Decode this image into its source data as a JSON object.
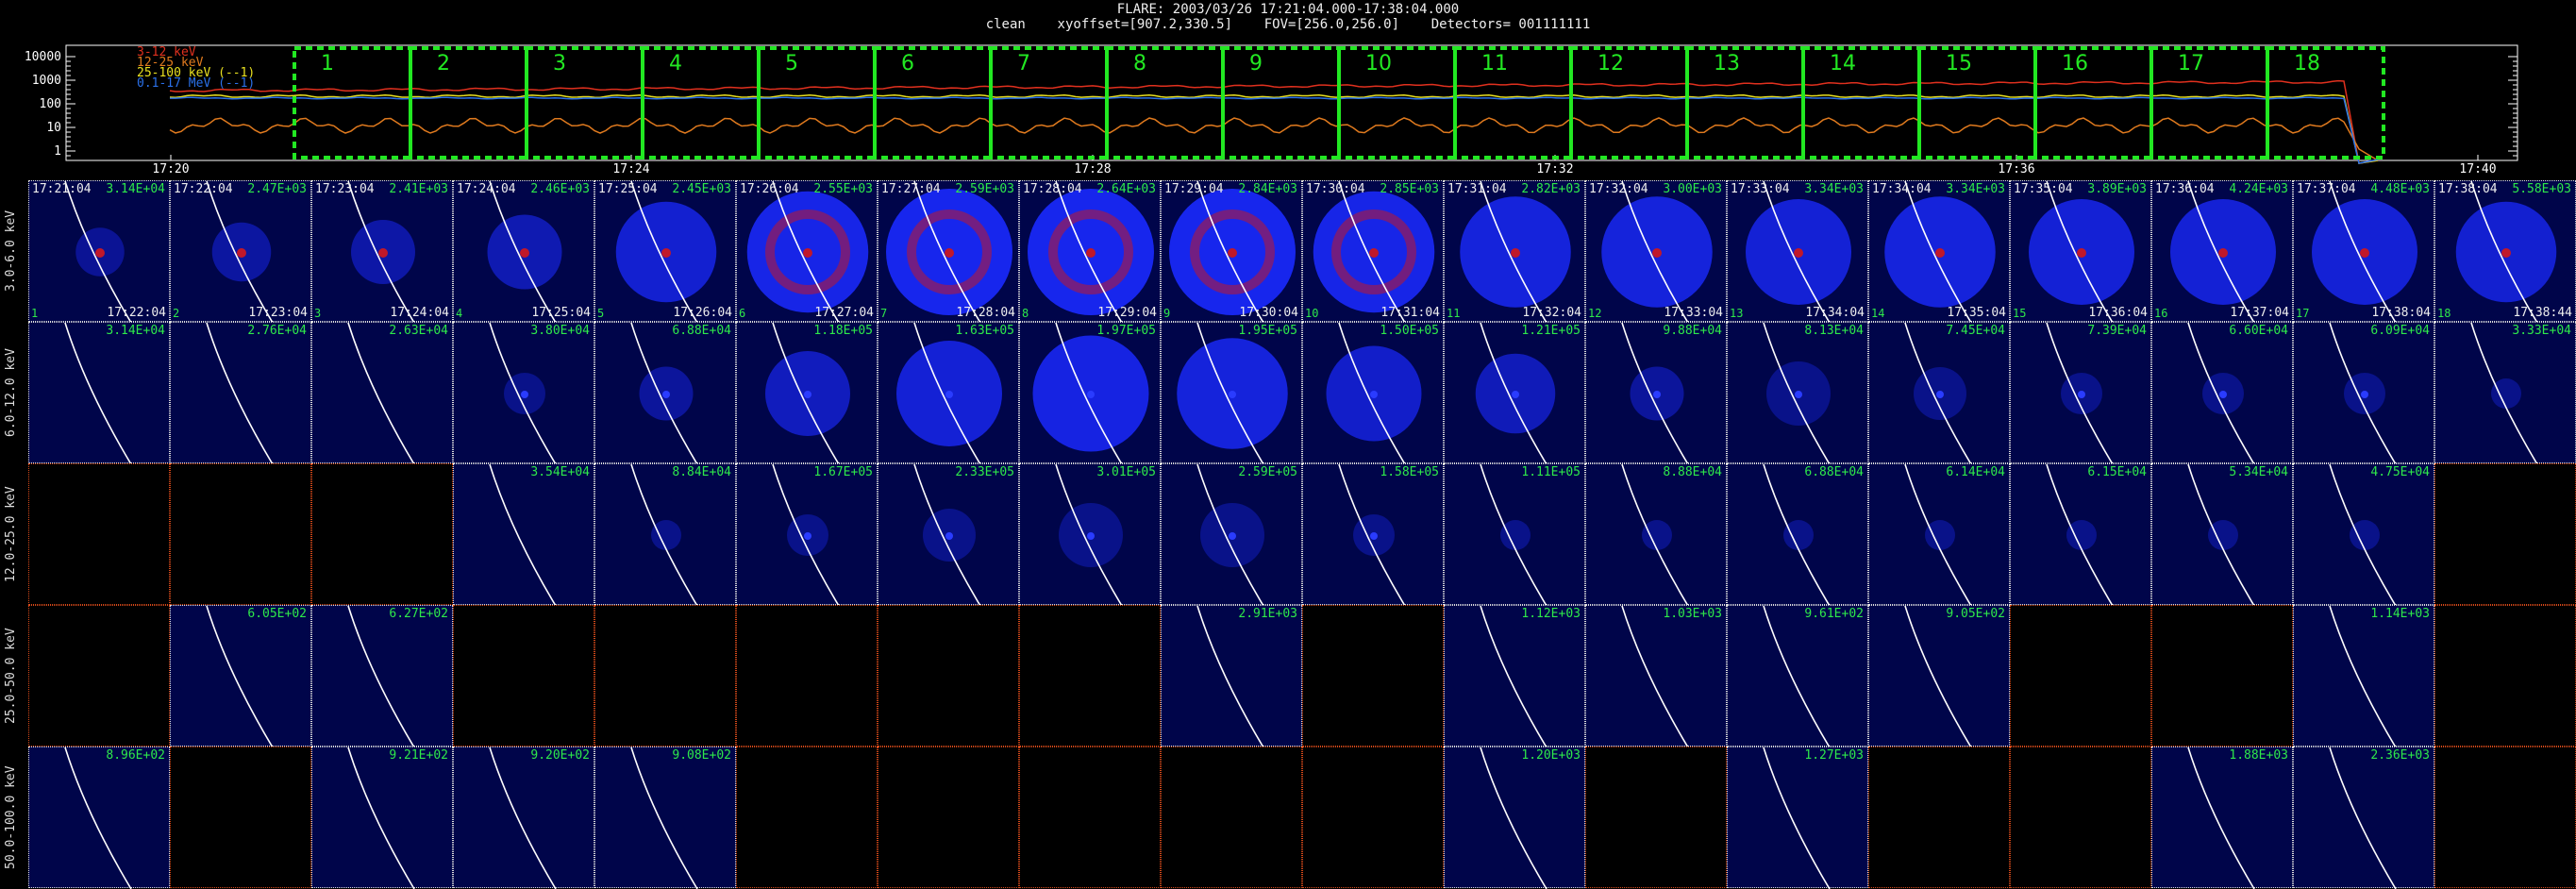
{
  "header": {
    "line1": "FLARE: 2003/03/26 17:21:04.000-17:38:04.000",
    "line2": "clean    xyoffset=[907.2,330.5]    FOV=[256.0,256.0]    Detectors= 001111111"
  },
  "lightcurve": {
    "y_ticks": [
      "10000",
      "1000",
      "100",
      "10",
      "1"
    ],
    "x_ticks": [
      "17:20",
      "17:24",
      "17:28",
      "17:32",
      "17:36",
      "17:40"
    ],
    "legend": [
      {
        "label": "3-12 keV",
        "color": "#e0301e"
      },
      {
        "label": "12-25 keV",
        "color": "#e07a1e"
      },
      {
        "label": "25-100 keV (--1)",
        "color": "#e8e020"
      },
      {
        "label": "0.1-17 MeV (--1)",
        "color": "#2a70e8"
      }
    ],
    "intervals": [
      "1",
      "2",
      "3",
      "4",
      "5",
      "6",
      "7",
      "8",
      "9",
      "10",
      "11",
      "12",
      "13",
      "14",
      "15",
      "16",
      "17",
      "18"
    ],
    "interval_color": "#22e822"
  },
  "row_labels": [
    "3.0-6.0 keV",
    "6.0-12.0 keV",
    "12.0-25.0 keV",
    "25.0-50.0 keV",
    "50.0-100.0 keV"
  ],
  "start_times": [
    "17:21:04",
    "17:22:04",
    "17:23:04",
    "17:24:04",
    "17:25:04",
    "17:26:04",
    "17:27:04",
    "17:28:04",
    "17:29:04",
    "17:30:04",
    "17:31:04",
    "17:32:04",
    "17:33:04",
    "17:34:04",
    "17:35:04",
    "17:36:04",
    "17:37:04",
    "17:38:04"
  ],
  "end_times": [
    "17:22:04",
    "17:23:04",
    "17:24:04",
    "17:25:04",
    "17:26:04",
    "17:27:04",
    "17:28:04",
    "17:29:04",
    "17:30:04",
    "17:31:04",
    "17:32:04",
    "17:33:04",
    "17:34:04",
    "17:35:04",
    "17:36:04",
    "17:37:04",
    "17:38:04",
    "17:38:44"
  ],
  "rows": [
    {
      "cells": [
        {
          "show": true,
          "peak": "3.14E+04"
        },
        {
          "show": true,
          "peak": "2.47E+03"
        },
        {
          "show": true,
          "peak": "2.41E+03"
        },
        {
          "show": true,
          "peak": "2.46E+03"
        },
        {
          "show": true,
          "peak": "2.45E+03"
        },
        {
          "show": true,
          "peak": "2.55E+03"
        },
        {
          "show": true,
          "peak": "2.59E+03"
        },
        {
          "show": true,
          "peak": "2.64E+03"
        },
        {
          "show": true,
          "peak": "2.84E+03"
        },
        {
          "show": true,
          "peak": "2.85E+03"
        },
        {
          "show": true,
          "peak": "2.82E+03"
        },
        {
          "show": true,
          "peak": "3.00E+03"
        },
        {
          "show": true,
          "peak": "3.34E+03"
        },
        {
          "show": true,
          "peak": "3.34E+03"
        },
        {
          "show": true,
          "peak": "3.89E+03"
        },
        {
          "show": true,
          "peak": "4.24E+03"
        },
        {
          "show": true,
          "peak": "4.48E+03"
        },
        {
          "show": true,
          "peak": "5.58E+03"
        }
      ]
    },
    {
      "cells": [
        {
          "show": true,
          "peak": "3.14E+04"
        },
        {
          "show": true,
          "peak": "2.76E+04"
        },
        {
          "show": true,
          "peak": "2.63E+04"
        },
        {
          "show": true,
          "peak": "3.80E+04"
        },
        {
          "show": true,
          "peak": "6.88E+04"
        },
        {
          "show": true,
          "peak": "1.18E+05"
        },
        {
          "show": true,
          "peak": "1.63E+05"
        },
        {
          "show": true,
          "peak": "1.97E+05"
        },
        {
          "show": true,
          "peak": "1.95E+05"
        },
        {
          "show": true,
          "peak": "1.50E+05"
        },
        {
          "show": true,
          "peak": "1.21E+05"
        },
        {
          "show": true,
          "peak": "9.88E+04"
        },
        {
          "show": true,
          "peak": "8.13E+04"
        },
        {
          "show": true,
          "peak": "7.45E+04"
        },
        {
          "show": true,
          "peak": "7.39E+04"
        },
        {
          "show": true,
          "peak": "6.60E+04"
        },
        {
          "show": true,
          "peak": "6.09E+04"
        },
        {
          "show": true,
          "peak": "3.33E+04"
        }
      ]
    },
    {
      "cells": [
        {
          "show": false,
          "peak": ""
        },
        {
          "show": false,
          "peak": ""
        },
        {
          "show": false,
          "peak": ""
        },
        {
          "show": true,
          "peak": "3.54E+04"
        },
        {
          "show": true,
          "peak": "8.84E+04"
        },
        {
          "show": true,
          "peak": "1.67E+05"
        },
        {
          "show": true,
          "peak": "2.33E+05"
        },
        {
          "show": true,
          "peak": "3.01E+05"
        },
        {
          "show": true,
          "peak": "2.59E+05"
        },
        {
          "show": true,
          "peak": "1.58E+05"
        },
        {
          "show": true,
          "peak": "1.11E+05"
        },
        {
          "show": true,
          "peak": "8.88E+04"
        },
        {
          "show": true,
          "peak": "6.88E+04"
        },
        {
          "show": true,
          "peak": "6.14E+04"
        },
        {
          "show": true,
          "peak": "6.15E+04"
        },
        {
          "show": true,
          "peak": "5.34E+04"
        },
        {
          "show": true,
          "peak": "4.75E+04"
        },
        {
          "show": false,
          "peak": ""
        }
      ]
    },
    {
      "cells": [
        {
          "show": false,
          "peak": ""
        },
        {
          "show": true,
          "peak": "6.05E+02"
        },
        {
          "show": true,
          "peak": "6.27E+02"
        },
        {
          "show": false,
          "peak": ""
        },
        {
          "show": false,
          "peak": ""
        },
        {
          "show": false,
          "peak": ""
        },
        {
          "show": false,
          "peak": ""
        },
        {
          "show": false,
          "peak": ""
        },
        {
          "show": true,
          "peak": "2.91E+03"
        },
        {
          "show": false,
          "peak": ""
        },
        {
          "show": true,
          "peak": "1.12E+03"
        },
        {
          "show": true,
          "peak": "1.03E+03"
        },
        {
          "show": true,
          "peak": "9.61E+02"
        },
        {
          "show": true,
          "peak": "9.05E+02"
        },
        {
          "show": false,
          "peak": ""
        },
        {
          "show": false,
          "peak": ""
        },
        {
          "show": true,
          "peak": "1.14E+03"
        },
        {
          "show": false,
          "peak": ""
        }
      ]
    },
    {
      "cells": [
        {
          "show": true,
          "peak": "8.96E+02"
        },
        {
          "show": false,
          "peak": ""
        },
        {
          "show": true,
          "peak": "9.21E+02"
        },
        {
          "show": true,
          "peak": "9.20E+02"
        },
        {
          "show": true,
          "peak": "9.08E+02"
        },
        {
          "show": false,
          "peak": ""
        },
        {
          "show": false,
          "peak": ""
        },
        {
          "show": false,
          "peak": ""
        },
        {
          "show": false,
          "peak": ""
        },
        {
          "show": false,
          "peak": ""
        },
        {
          "show": true,
          "peak": "1.20E+03"
        },
        {
          "show": false,
          "peak": ""
        },
        {
          "show": true,
          "peak": "1.27E+03"
        },
        {
          "show": false,
          "peak": ""
        },
        {
          "show": false,
          "peak": ""
        },
        {
          "show": true,
          "peak": "1.88E+03"
        },
        {
          "show": true,
          "peak": "2.36E+03"
        },
        {
          "show": false,
          "peak": ""
        }
      ]
    }
  ],
  "colors": {
    "image_bg": "#00054a",
    "blob": "#1a2aff",
    "core": "#c0182a",
    "limb": "#ffffff",
    "peak_text": "#2ee84a",
    "blank_border": "#d84a1a"
  }
}
